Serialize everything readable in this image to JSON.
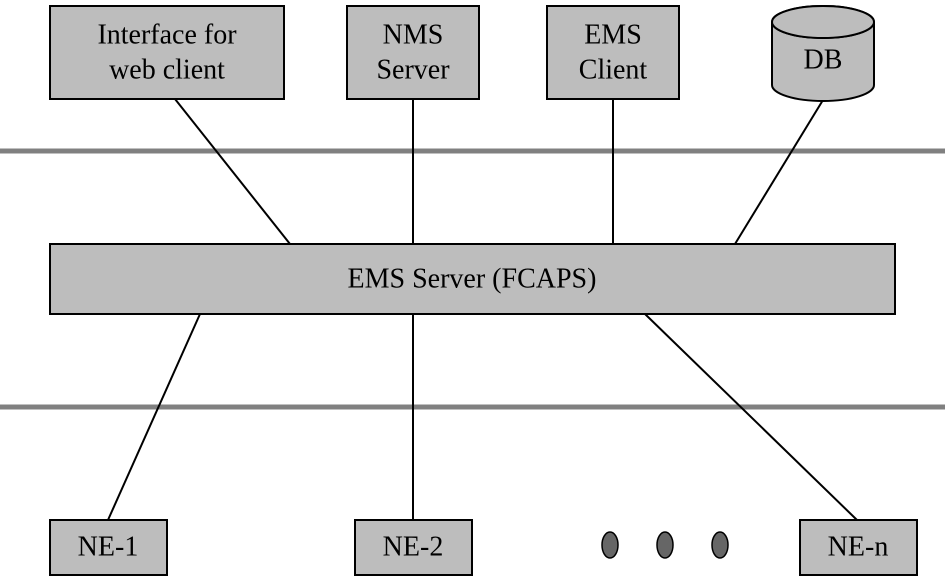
{
  "top": {
    "interface": {
      "line1": "Interface for",
      "line2": "web client"
    },
    "nms": {
      "line1": "NMS",
      "line2": "Server"
    },
    "ems_client": {
      "line1": "EMS",
      "line2": "Client"
    },
    "db": {
      "label": "DB"
    }
  },
  "middle": {
    "ems_server": "EMS Server (FCAPS)"
  },
  "bottom": {
    "ne1": "NE-1",
    "ne2": "NE-2",
    "nen": "NE-n"
  }
}
